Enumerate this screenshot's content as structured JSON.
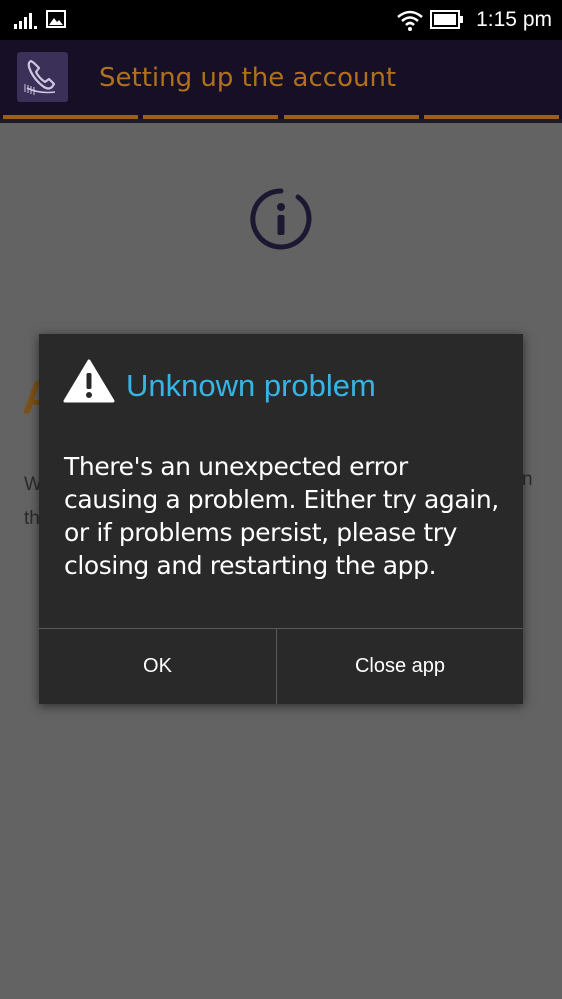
{
  "status_bar": {
    "time": "1:15 pm",
    "icons": [
      "signal-icon",
      "gallery-icon",
      "wifi-icon",
      "battery-icon"
    ]
  },
  "app_bar": {
    "title": "Setting up the account",
    "logo_icon": "phone-icon",
    "progress_steps": 4,
    "colors": {
      "background": "#170f26",
      "title": "#b0701c",
      "progress": "#9a601a"
    }
  },
  "background": {
    "info_icon": "info-icon",
    "heading_fragment": "A",
    "text_left_fragment": "W\nth",
    "text_right_fragment": "n"
  },
  "dialog": {
    "title": "Unknown problem",
    "title_icon": "warning-icon",
    "message": "There's an unexpected error causing a problem. Either try again, or if problems persist, please try closing and restarting the app.",
    "buttons": {
      "ok": "OK",
      "close": "Close app"
    },
    "colors": {
      "title": "#35b5e5",
      "background": "#292929"
    }
  }
}
